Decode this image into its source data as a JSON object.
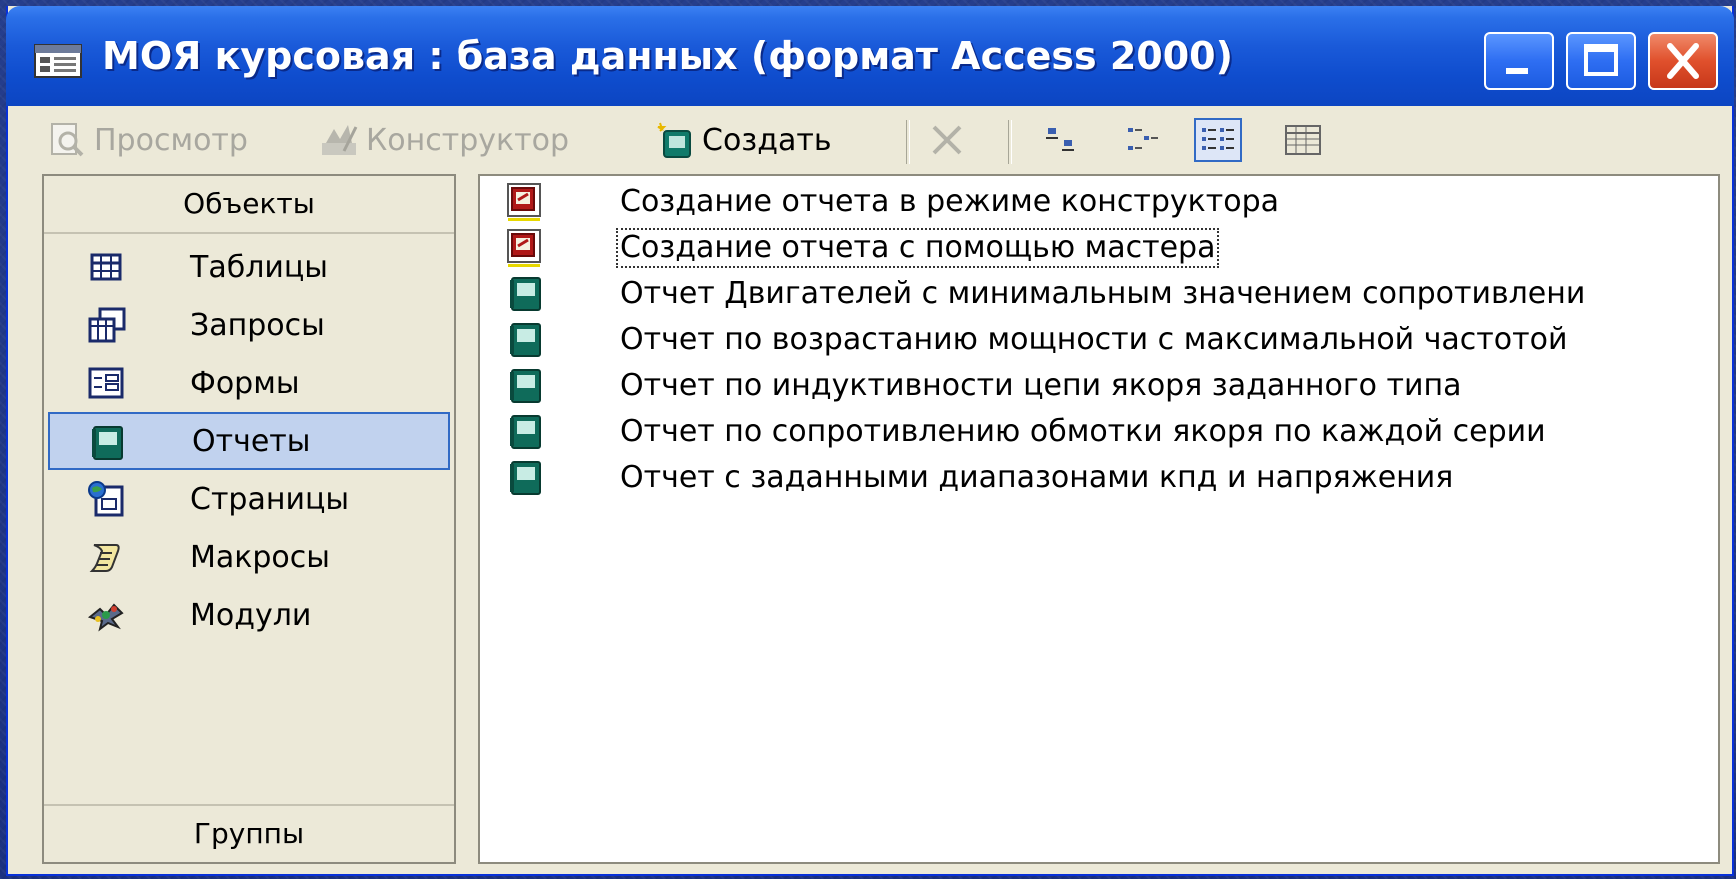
{
  "window": {
    "title": "МОЯ курсовая : база данных (формат Access 2000)",
    "title_icon": "database-window-icon",
    "buttons": {
      "minimize": "minimize-icon",
      "maximize": "maximize-icon",
      "close": "close-icon"
    }
  },
  "toolbar": {
    "preview_label": "Просмотр",
    "design_label": "Конструктор",
    "create_label": "Создать",
    "delete_icon": "delete-icon",
    "view_icons": [
      "large-icons-view-icon",
      "small-icons-view-icon",
      "list-view-icon",
      "details-view-icon"
    ],
    "active_view": "list-view-icon"
  },
  "objects": {
    "header": "Объекты",
    "footer": "Группы",
    "selected": "Отчеты",
    "items": [
      {
        "label": "Таблицы",
        "icon": "tables-icon"
      },
      {
        "label": "Запросы",
        "icon": "queries-icon"
      },
      {
        "label": "Формы",
        "icon": "forms-icon"
      },
      {
        "label": "Отчеты",
        "icon": "reports-icon"
      },
      {
        "label": "Страницы",
        "icon": "pages-icon"
      },
      {
        "label": "Макросы",
        "icon": "macros-icon"
      },
      {
        "label": "Модули",
        "icon": "modules-icon"
      }
    ]
  },
  "reports": {
    "items": [
      {
        "label": "Создание отчета в режиме конструктора",
        "icon": "create-shortcut-icon"
      },
      {
        "label": "Создание отчета с помощью мастера",
        "icon": "create-shortcut-icon",
        "focused": true
      },
      {
        "label": "Отчет Двигателей с минимальным значением сопротивлени",
        "icon": "report-icon"
      },
      {
        "label": "Отчет по возрастанию мощности с максимальной  частотой",
        "icon": "report-icon"
      },
      {
        "label": "Отчет по индуктивности цепи якоря заданного типа",
        "icon": "report-icon"
      },
      {
        "label": "Отчет по сопротивлению обмотки якоря по каждой серии",
        "icon": "report-icon"
      },
      {
        "label": "Отчет с заданными диапазонами кпд и напряжения",
        "icon": "report-icon"
      }
    ]
  },
  "colors": {
    "titlebar": "#0f4dce",
    "selection": "#c1d2ee",
    "selection_border": "#316ac5",
    "report_icon": "#0f6b5a"
  }
}
